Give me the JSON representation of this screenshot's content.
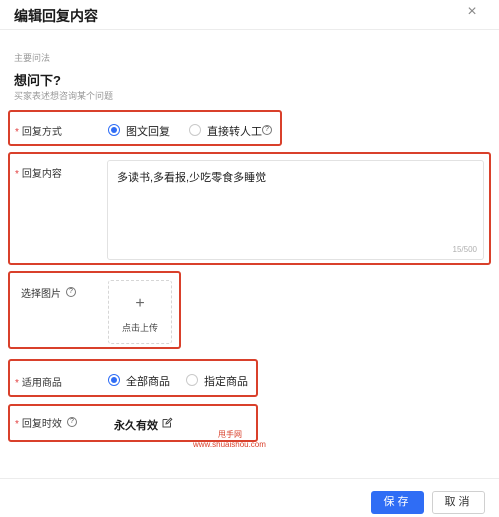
{
  "dialog": {
    "title": "编辑回复内容",
    "close_glyph": "×",
    "close_icon": "close-icon"
  },
  "question": {
    "section_label": "主要问法",
    "text": "想问下?",
    "description": "买家表述想咨询某个问题"
  },
  "reply_method": {
    "required_mark": "*",
    "label": "回复方式",
    "options": [
      {
        "label": "图文回复",
        "selected": true
      },
      {
        "label": "直接转人工",
        "selected": false
      }
    ],
    "help_glyph": "?"
  },
  "reply_content": {
    "required_mark": "*",
    "label": "回复内容",
    "value": "多读书,多看报,少吃零食多睡觉",
    "counter": "15/500"
  },
  "image": {
    "label": "选择图片",
    "help_glyph": "?",
    "upload_plus": "+",
    "upload_text": "点击上传"
  },
  "products": {
    "required_mark": "*",
    "label": "适用商品",
    "options": [
      {
        "label": "全部商品",
        "selected": true
      },
      {
        "label": "指定商品",
        "selected": false
      }
    ]
  },
  "validity": {
    "required_mark": "*",
    "label": "回复时效",
    "help_glyph": "?",
    "value": "永久有效",
    "edit_icon": "edit-icon"
  },
  "watermark": {
    "line1": "甩手网",
    "line2": "www.shuaishou.com"
  },
  "footer": {
    "save_label": "保存",
    "cancel_label": "取消"
  },
  "colors": {
    "primary": "#2f6df5",
    "highlight_border": "#d9402b",
    "required": "#e23d3d"
  }
}
